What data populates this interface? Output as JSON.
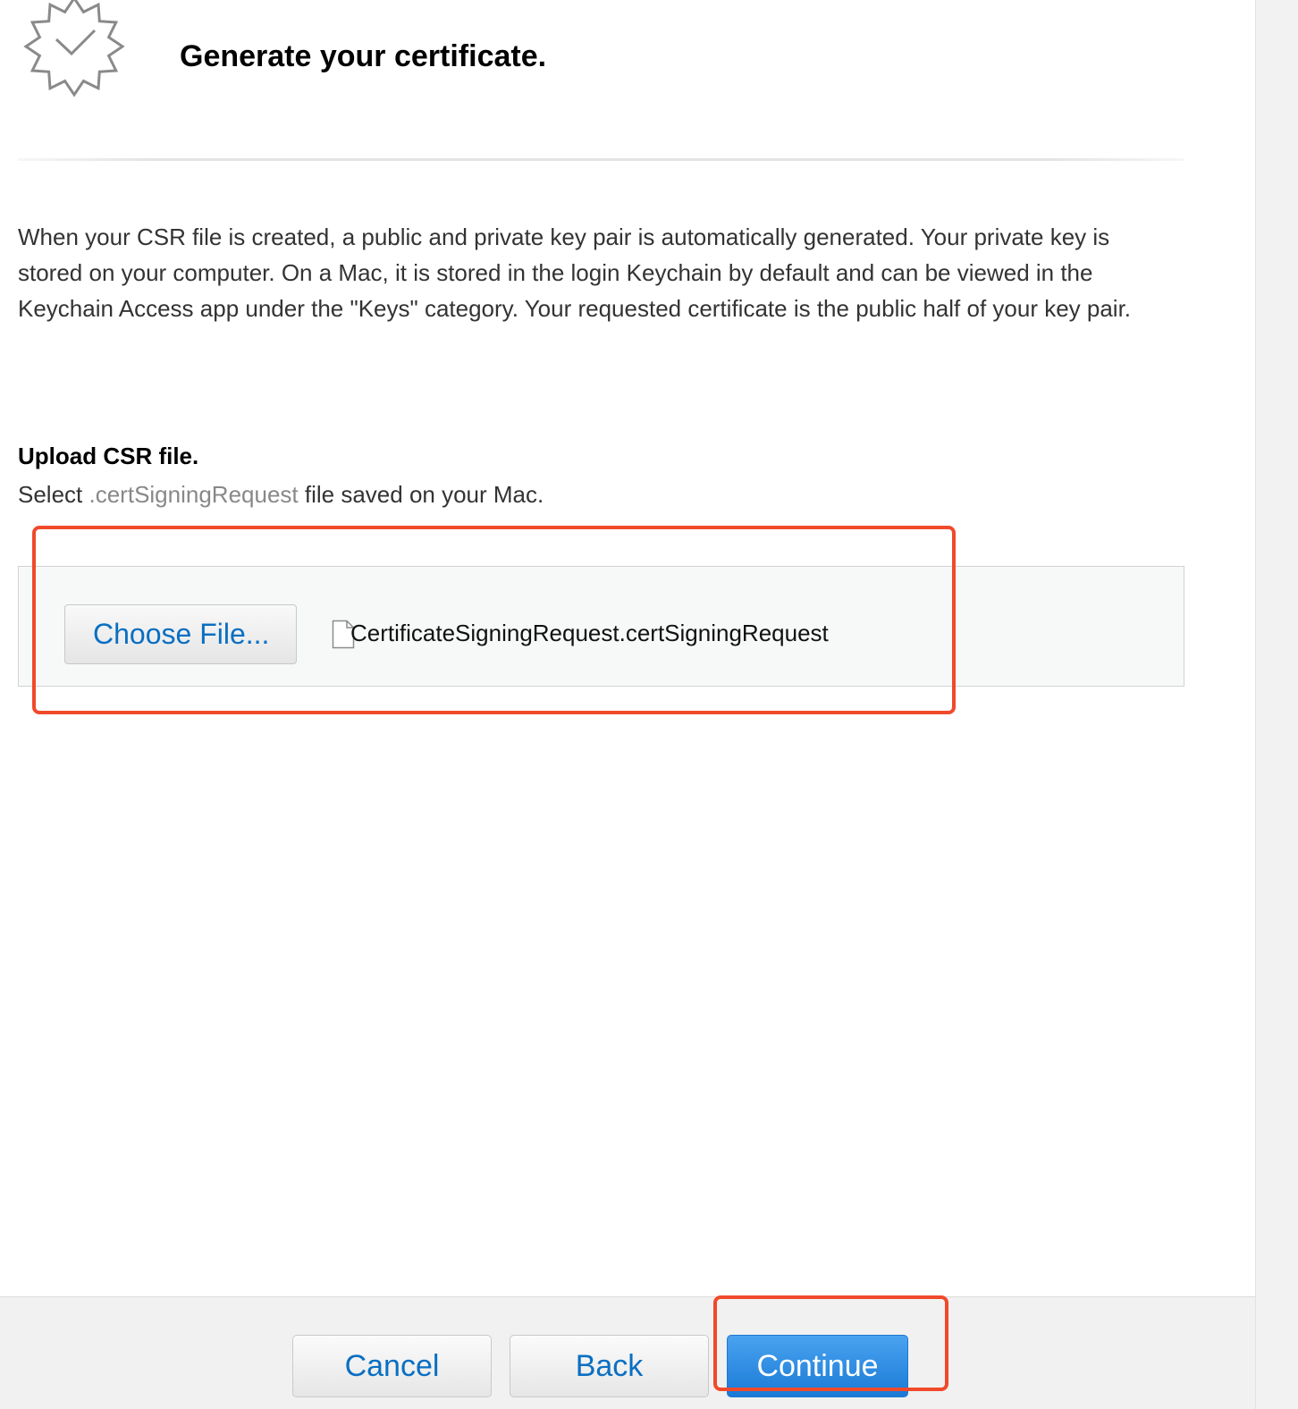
{
  "header": {
    "title": "Generate your certificate.",
    "icon": "certificate-badge-icon"
  },
  "description": "When your CSR file is created, a public and private key pair is automatically generated. Your private key is stored on your computer. On a Mac, it is stored in the login Keychain by default and can be viewed in the Keychain Access app under the \"Keys\" category. Your requested certificate is the public half of your key pair.",
  "upload": {
    "heading": "Upload CSR file.",
    "instruction_prefix": "Select",
    "extension": ".certSigningRequest",
    "instruction_suffix": "file saved on your Mac.",
    "choose_label": "Choose File...",
    "file_icon": "document-icon",
    "selected_file": "CertificateSigningRequest.certSigningRequest"
  },
  "footer": {
    "cancel_label": "Cancel",
    "back_label": "Back",
    "continue_label": "Continue"
  },
  "colors": {
    "accent": "#0a6fc2",
    "primary_button": "#1a7ad6",
    "highlight": "#f04a2b"
  }
}
